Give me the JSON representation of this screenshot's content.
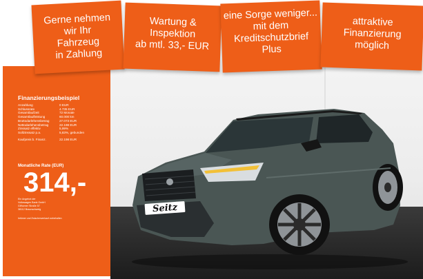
{
  "banners": [
    {
      "text": "Gerne nehmen\nwir Ihr\nFahrzeug\nin Zahlung"
    },
    {
      "text": "Wartung &\nInspektion\nab mtl. 33,- EUR"
    },
    {
      "text": "eine Sorge weniger...\nmit dem\nKreditschutzbrief\nPlus"
    },
    {
      "text": "attraktive\nFinanzierung\nmöglich"
    }
  ],
  "financing": {
    "title": "Finanzierungsbeispiel",
    "rows": [
      {
        "label": "Anzahlung",
        "value": "0 EUR"
      },
      {
        "label": "Schlussrate",
        "value": "4.735 EUR"
      },
      {
        "label": "Gesamtlaufzeit",
        "value": "72 Monate"
      },
      {
        "label": "Gesamtlaufleistung",
        "value": "60.000 km"
      },
      {
        "label": "Bruttodarlehensbetrag",
        "value": "27.073 EUR"
      },
      {
        "label": "Nettodarlehensbetrag",
        "value": "22.198 EUR"
      },
      {
        "label": "Zinssatz effektiv",
        "value": "5,99%"
      },
      {
        "label": "Sollzinssatz p.a.",
        "value": "5,83%, gebunden"
      }
    ],
    "purchase_label": "Kaufpreis b. Finanz.",
    "purchase_value": "22.198 EUR",
    "rate_label": "Monatliche Rate (EUR)",
    "rate_value": "314,-",
    "address_lines": [
      "Ein Angebot der",
      "Volkswagen Bank GmbH",
      "Gifhorner Straße 57",
      "38112 Braunschweig"
    ],
    "fineprint": "Irrtümer und Zwischenverkauf vorbehalten"
  },
  "car": {
    "plate_text": "Seitz",
    "body_color": "#4a5654"
  },
  "colors": {
    "accent": "#ee5e18"
  }
}
